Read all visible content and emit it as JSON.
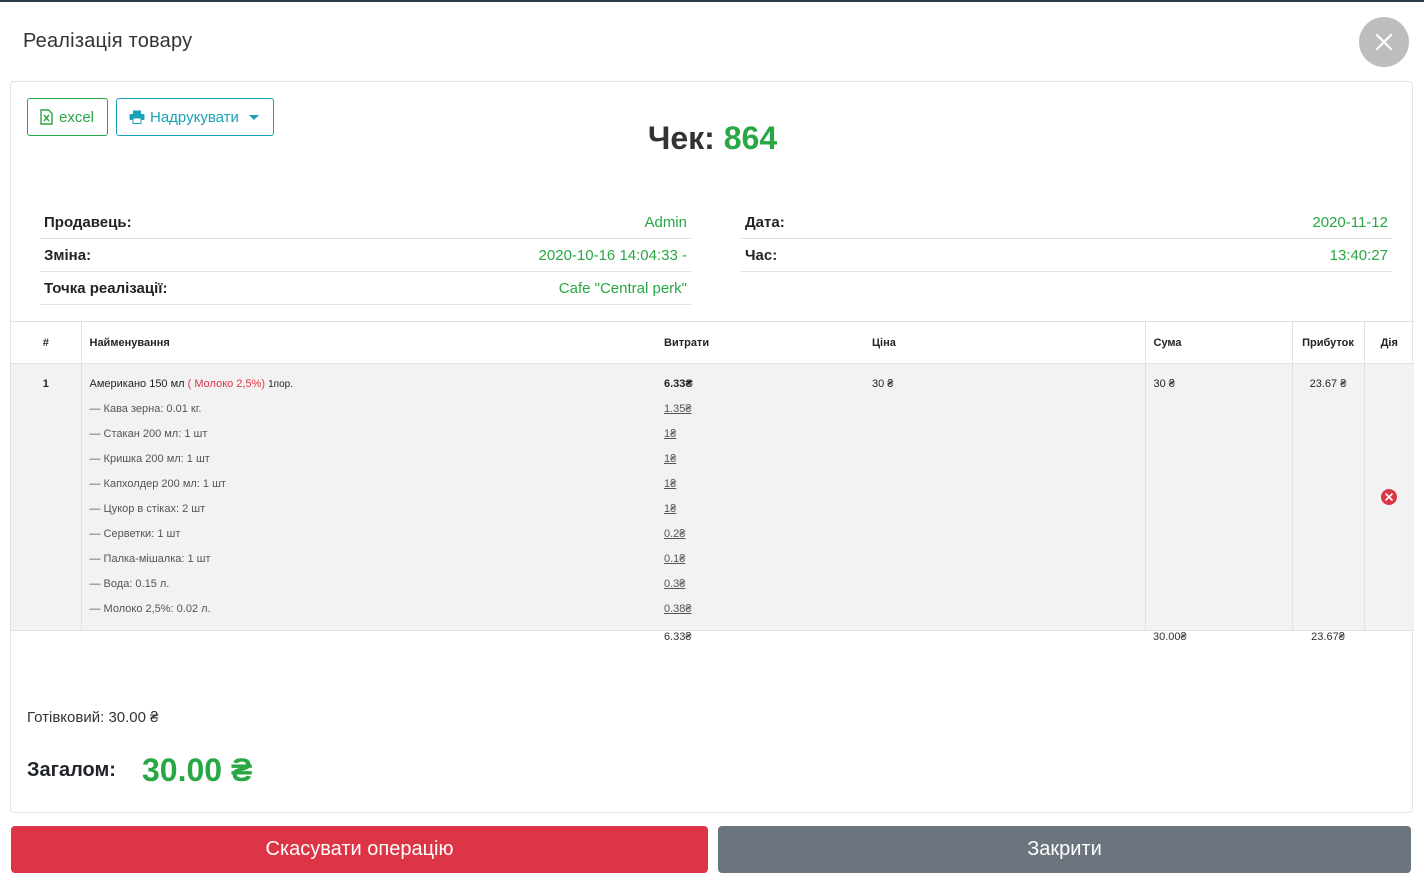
{
  "modal": {
    "title": "Реалізація товару"
  },
  "toolbar": {
    "excel_label": "excel",
    "print_label": "Надрукувати"
  },
  "receipt": {
    "label": "Чек:",
    "number": "864"
  },
  "info_left": [
    {
      "label": "Продавець:",
      "value": "Admin"
    },
    {
      "label": "Зміна:",
      "value": "2020-10-16 14:04:33 -"
    },
    {
      "label": "Точка реалізації:",
      "value": "Cafe \"Central perk\""
    }
  ],
  "info_right": [
    {
      "label": "Дата:",
      "value": "2020-11-12"
    },
    {
      "label": "Час:",
      "value": "13:40:27"
    }
  ],
  "table": {
    "headers": [
      "#",
      "Найменування",
      "Витрати",
      "Ціна",
      "Сума",
      "Прибуток",
      "Дія"
    ],
    "row": {
      "index": "1",
      "name": "Американо 150 мл",
      "modifier": "( Молоко 2,5%)",
      "qty": "1пор.",
      "cost": "6.33₴",
      "price": "30 ₴",
      "sum": "30 ₴",
      "profit": "23.67 ₴",
      "ingredients": [
        {
          "text": "— Кава зерна: 0.01 кг.",
          "cost": "1.35₴"
        },
        {
          "text": "— Стакан 200 мл: 1 шт",
          "cost": "1₴"
        },
        {
          "text": "— Кришка 200 мл: 1 шт",
          "cost": "1₴"
        },
        {
          "text": "— Капхолдер 200 мл: 1 шт",
          "cost": "1₴"
        },
        {
          "text": "— Цукор в стіках: 2 шт",
          "cost": "1₴"
        },
        {
          "text": "— Серветки: 1 шт",
          "cost": "0.2₴"
        },
        {
          "text": "— Палка-мішалка: 1 шт",
          "cost": "0.1₴"
        },
        {
          "text": "— Вода: 0.15 л.",
          "cost": "0.3₴"
        },
        {
          "text": "— Молоко 2,5%: 0.02 л.",
          "cost": "0.38₴"
        }
      ]
    },
    "totals": {
      "cost": "6.33₴",
      "sum": "30.00₴",
      "profit": "23.67₴"
    }
  },
  "payment": {
    "cash": "Готівковий: 30.00 ₴"
  },
  "grand_total": {
    "label": "Загалом:",
    "value": "30.00 ₴"
  },
  "footer": {
    "cancel_label": "Скасувати операцію",
    "close_label": "Закрити"
  },
  "icons": {
    "close": "close-icon",
    "excel": "excel-file-icon",
    "print": "printer-icon",
    "delete": "delete-circle-icon"
  },
  "colors": {
    "accent": "#28a745",
    "danger": "#dc3545",
    "secondary": "#6c757d",
    "info": "#17a2b8"
  }
}
